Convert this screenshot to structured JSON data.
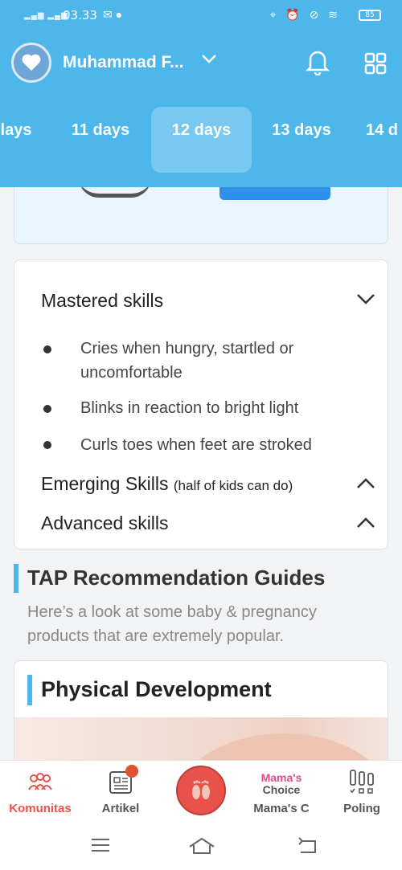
{
  "status_bar": {
    "time": "03.33",
    "battery": "85"
  },
  "header": {
    "username": "Muhammad F...",
    "days": [
      {
        "label": "lays"
      },
      {
        "label": "11 days"
      },
      {
        "label": "12 days",
        "active": true
      },
      {
        "label": "13 days"
      },
      {
        "label": "14 d"
      }
    ]
  },
  "skills": {
    "mastered_title": "Mastered skills",
    "mastered_items": [
      "Cries when hungry, startled or uncomfortable",
      "Blinks in reaction to bright light",
      "Curls toes when feet are stroked"
    ],
    "emerging_title": "Emerging Skills",
    "emerging_note": "(half of kids can do)",
    "advanced_title": "Advanced skills"
  },
  "guides": {
    "title": "TAP Recommendation Guides",
    "description": "Here’s a look at some baby & pregnancy products that are extremely popular."
  },
  "physical": {
    "title": "Physical Development"
  },
  "bottom_nav": {
    "items": [
      {
        "label": "Komunitas",
        "active": true
      },
      {
        "label": "Artikel"
      },
      {
        "label": ""
      },
      {
        "label": "Mama's C"
      },
      {
        "label": "Poling"
      }
    ],
    "mama_logo_line1": "Mama's",
    "mama_logo_line2": "Choice"
  },
  "colors": {
    "header_blue": "#4db6ea",
    "accent_red": "#e8524a"
  }
}
